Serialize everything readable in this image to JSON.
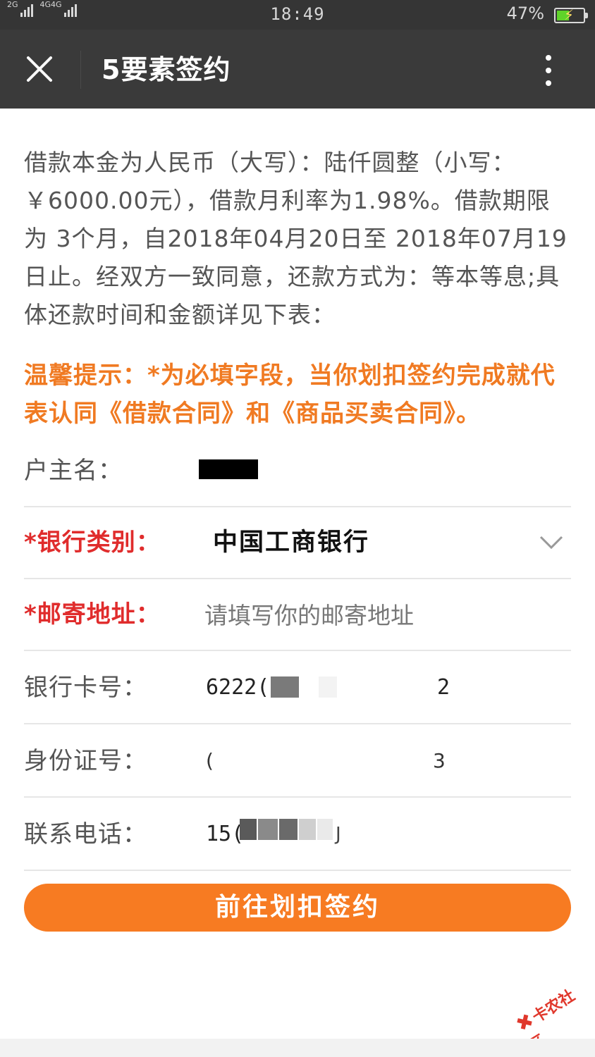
{
  "status_bar": {
    "signal1_label": "2G",
    "signal2_label": "4G4G",
    "time": "18:49",
    "battery": "47%",
    "battery_level": 0.47
  },
  "nav": {
    "title": "5要素签约"
  },
  "intro_text": "借款本金为人民币（大写）：陆仟圆整（小写：￥6000.00元），借款月利率为1.98%。借款期限为 3个月，自2018年04月20日至 2018年07月19日止。经双方一致同意，还款方式为：等本等息;具体还款时间和金额详见下表：",
  "notice_text": "温馨提示：*为必填字段，当你划扣签约完成就代表认同《借款合同》和《商品买卖合同》。",
  "form": {
    "holder_name_label": "户主名：",
    "bank_type_label": "*银行类别：",
    "bank_type_value": "中国工商银行",
    "address_label": "*邮寄地址：",
    "address_placeholder": "请填写你的邮寄地址",
    "card_label": "银行卡号：",
    "card_prefix": "6222(",
    "card_suffix": "2",
    "id_label": "身份证号：",
    "id_prefix": "(",
    "id_suffix": "3",
    "phone_label": "联系电话：",
    "phone_prefix": "15(",
    "phone_suffix": "J"
  },
  "submit_label": "前往划扣签约",
  "watermark_text": "卡农社区",
  "colors": {
    "accent": "#f77b22",
    "notice": "#f07a22",
    "required": "#e02c2c",
    "nav_bg": "#3a3a3a"
  },
  "icons": {
    "close": "close-icon",
    "more": "more-vertical-icon",
    "dropdown": "chevron-down-icon"
  }
}
